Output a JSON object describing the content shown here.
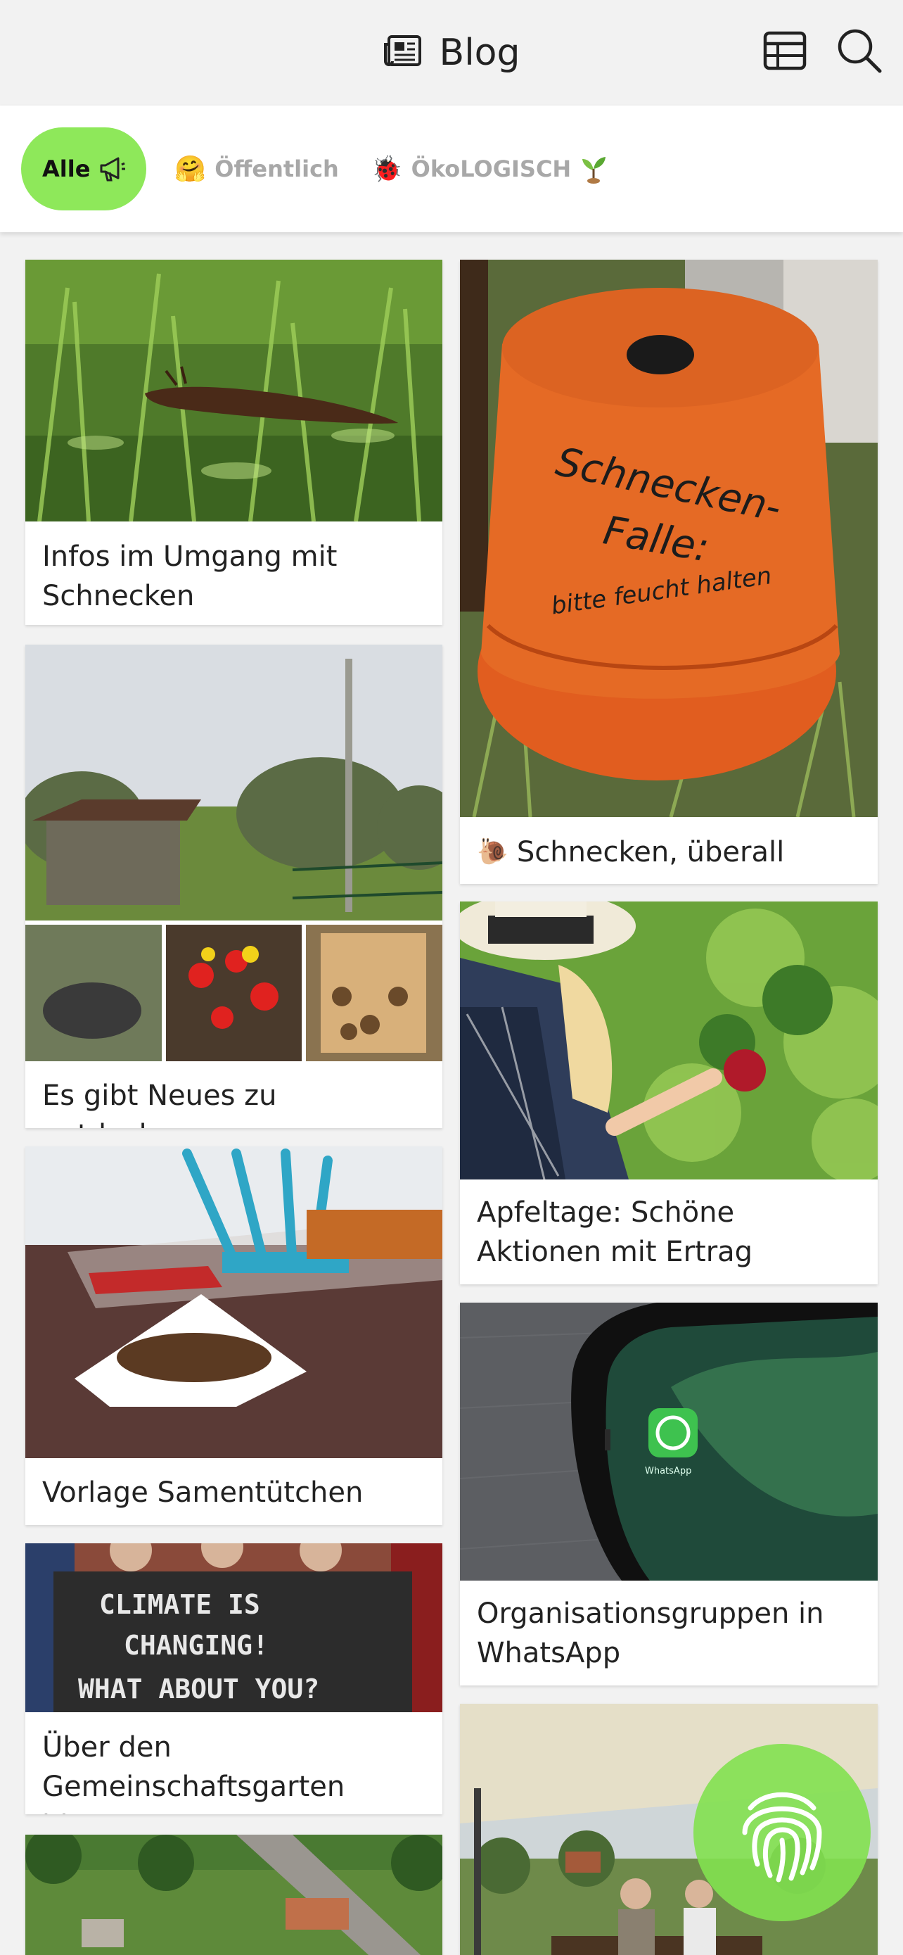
{
  "header": {
    "title": "Blog",
    "icons": {
      "blog": "newspaper-icon",
      "view": "table-view-icon",
      "search": "search-icon"
    }
  },
  "filters": [
    {
      "label": "Alle",
      "icon": "megaphone-icon",
      "active": true
    },
    {
      "label": "Öffentlich",
      "emoji": "🤗",
      "active": false
    },
    {
      "label": "ÖkoLOGISCH",
      "emoji": "🐞",
      "trailing_icon": "seedling-icon",
      "active": false
    }
  ],
  "posts": {
    "slugs": {
      "title": "Infos im Umgang mit Schnecken"
    },
    "snail_trap": {
      "title": "Schnecken, überall",
      "emoji": "🐌"
    },
    "garden_news": {
      "title": "Es gibt Neues zu entdecken"
    },
    "apples": {
      "title": "Apfeltage: Schöne Aktionen mit Ertrag"
    },
    "seed_bags": {
      "title": "Vorlage Samentütchen"
    },
    "whatsapp": {
      "title": "Organisationsgruppen in WhatsApp"
    },
    "climate": {
      "title": "Über den Gemeinschaftsgarten hinaus"
    }
  },
  "image_text": {
    "pot_line1": "Schnecken-",
    "pot_line2": "Falle:",
    "pot_line3": "bitte feucht halten",
    "sign_line1": "CLIMATE IS",
    "sign_line2": "CHANGING!",
    "sign_line3": "WHAT ABOUT YOU?",
    "app_label": "WhatsApp"
  },
  "colors": {
    "accent_green": "#8ee85a",
    "background": "#f2f2f2",
    "inactive_filter": "#a8a8a8"
  },
  "fab": {
    "icon": "fingerprint-icon"
  }
}
